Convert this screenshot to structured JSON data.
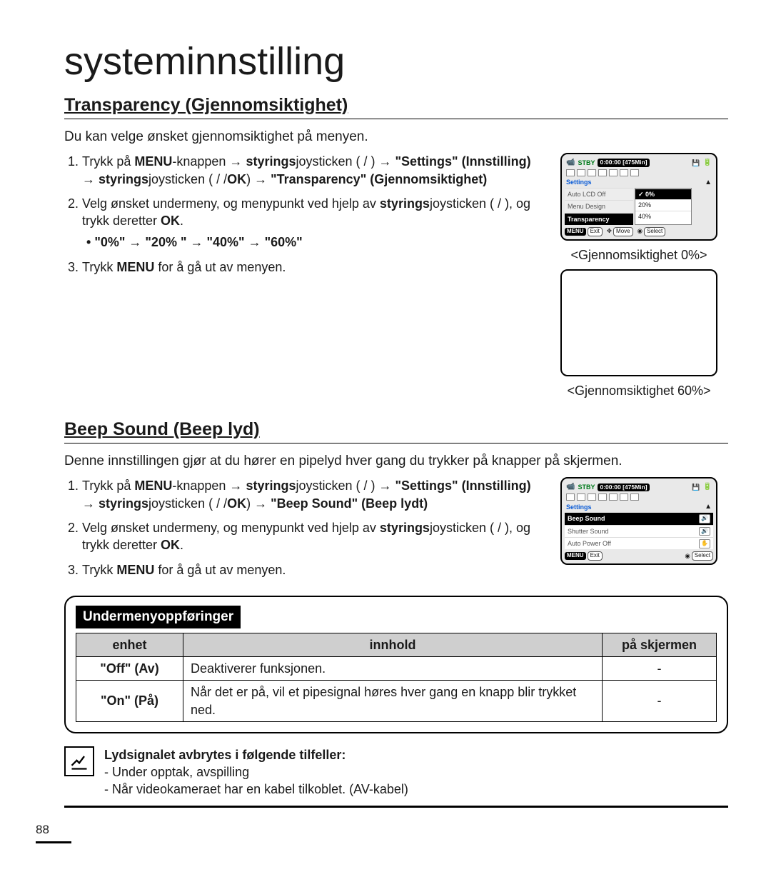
{
  "page": {
    "title": "systeminnstilling",
    "number": "88"
  },
  "transparency": {
    "heading": "Transparency (Gjennomsiktighet)",
    "intro": "Du kan velge ønsket gjennomsiktighet på menyen.",
    "step1_a": "Trykk på ",
    "step1_menu": "MENU",
    "step1_b": "-knappen ",
    "step1_styr": "styrings",
    "step1_joy": "joysticken (   /   ) ",
    "step1_settings": "\"Settings\" (Innstilling)",
    "step1_joy2": "joysticken (   /   /",
    "step1_ok": "OK",
    "step1_c": ") ",
    "step1_trans": "\"Transparency\" (Gjennomsiktighet)",
    "step2_a": "Velg ønsket undermeny, og menypunkt ved hjelp av ",
    "step2_joy": "joysticken (   /   ), og trykk deretter ",
    "step2_ok": "OK",
    "step2_c": ".",
    "options": "\"0%\" → \"20% \" → \"40%\" → \"60%\"",
    "step3_a": "Trykk ",
    "step3_menu": "MENU",
    "step3_b": " for å gå ut av menyen.",
    "caption1": "<Gjennomsiktighet 0%>",
    "caption2": "<Gjennomsiktighet 60%>"
  },
  "lcd1": {
    "stby": "STBY",
    "time": "0:00:00 [475Min]",
    "settings_label": "Settings",
    "rows": {
      "r1": "Auto LCD Off",
      "r2": "Menu Design",
      "r3": "Transparency"
    },
    "popup": {
      "p1": "0%",
      "p2": "20%",
      "p3": "40%"
    },
    "footer": {
      "menu": "MENU",
      "exit": "Exit",
      "move": "Move",
      "select": "Select"
    }
  },
  "beep": {
    "heading": "Beep Sound (Beep lyd)",
    "intro": "Denne innstillingen gjør at du hører en pipelyd hver gang du trykker på knapper på skjermen.",
    "step1_a": "Trykk på ",
    "step1_menu": "MENU",
    "step1_b": "-knappen ",
    "step1_styr": "styrings",
    "step1_joy": "joysticken (   /   ) ",
    "step1_settings": "\"Settings\" (Innstilling)",
    "step1_joy2": "joysticken (   /   /",
    "step1_ok": "OK",
    "step1_c": ") ",
    "step1_beep": "\"Beep Sound\" (Beep lydt)",
    "step2_a": "Velg ønsket undermeny, og menypunkt ved hjelp av ",
    "step2_joy": "joysticken (   /   ), og trykk deretter ",
    "step2_ok": "OK",
    "step2_c": ".",
    "step3_a": "Trykk ",
    "step3_menu": "MENU",
    "step3_b": " for å gå ut av menyen."
  },
  "lcd2": {
    "stby": "STBY",
    "time": "0:00:00 [475Min]",
    "settings_label": "Settings",
    "rows": {
      "r1": "Beep Sound",
      "r2": "Shutter Sound",
      "r3": "Auto Power Off"
    },
    "chips": {
      "c1": "🔊",
      "c2": "🔊",
      "c3": "✋"
    },
    "footer": {
      "menu": "MENU",
      "exit": "Exit",
      "select": "Select"
    }
  },
  "submenu": {
    "title": "Undermenyoppføringer",
    "headers": {
      "h1": "enhet",
      "h2": "innhold",
      "h3": "på skjermen"
    },
    "rows": [
      {
        "unit": "\"Off\" (Av)",
        "content": "Deaktiverer funksjonen.",
        "screen": "-"
      },
      {
        "unit": "\"On\" (På)",
        "content": "Når det er på, vil et pipesignal høres hver gang en knapp blir trykket ned.",
        "screen": "-"
      }
    ]
  },
  "note": {
    "head": "Lydsignalet avbrytes i følgende tilfeller:",
    "l1": "- Under opptak, avspilling",
    "l2": "- Når videokameraet har en kabel tilkoblet. (AV-kabel)"
  }
}
